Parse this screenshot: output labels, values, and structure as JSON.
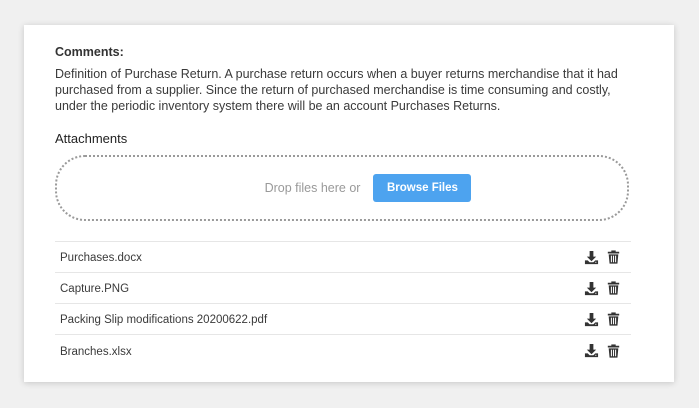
{
  "comments": {
    "title": "Comments:",
    "body": "Definition of Purchase Return. A purchase return occurs when a buyer returns merchandise that it had purchased from a supplier. Since the return of purchased merchandise is time consuming and costly, under the periodic inventory system there will be an account Purchases Returns."
  },
  "attachments": {
    "title": "Attachments",
    "drop_text": "Drop files here or",
    "browse_label": "Browse Files",
    "files": [
      {
        "name": "Purchases.docx"
      },
      {
        "name": "Capture.PNG"
      },
      {
        "name": "Packing Slip modifications 20200622.pdf"
      },
      {
        "name": "Branches.xlsx"
      }
    ],
    "icons": {
      "download": "download-icon",
      "delete": "trash-icon"
    }
  },
  "colors": {
    "accent": "#4da3ef",
    "icon": "#333333"
  }
}
